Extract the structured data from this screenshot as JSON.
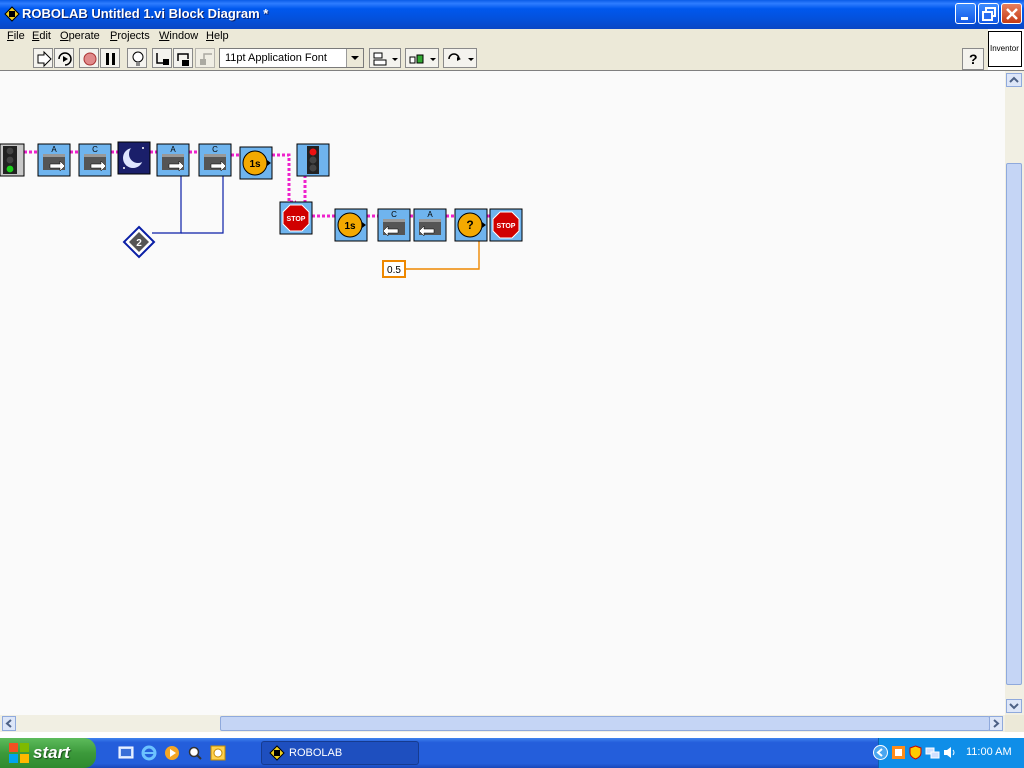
{
  "window": {
    "title": "ROBOLAB Untitled 1.vi Block Diagram *",
    "minimize_label": "Minimize",
    "maximize_label": "Restore",
    "close_label": "Close"
  },
  "menu": {
    "items": [
      "File",
      "Edit",
      "Operate",
      "Projects",
      "Window",
      "Help"
    ]
  },
  "toolbar": {
    "font_selector": "11pt Application Font",
    "level": "Inventor"
  },
  "diagram": {
    "motor_labels": [
      "A",
      "C",
      "A",
      "C",
      "C",
      "A"
    ],
    "wait_label": "1s",
    "constant_value": "0.5",
    "stop_label": "STOP",
    "container_number": "2",
    "random_wait_label": "?",
    "colors": {
      "wire_pink": "#ee22cc",
      "wire_blue": "#0a1fa6",
      "wire_orange": "#ee8800",
      "wait_yellow": "#f4a900",
      "stop_red": "#d00000",
      "block_blue": "#6fb4ee"
    }
  },
  "taskbar": {
    "start_label": "start",
    "task_label": "ROBOLAB",
    "clock": "11:00 AM"
  }
}
